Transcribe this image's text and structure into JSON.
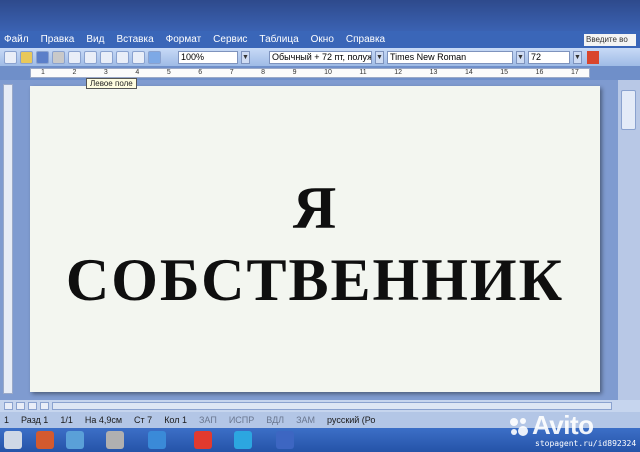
{
  "menu": {
    "items": [
      "Файл",
      "Правка",
      "Вид",
      "Вставка",
      "Формат",
      "Сервис",
      "Таблица",
      "Окно",
      "Справка"
    ],
    "help_box": "Введите во"
  },
  "toolbar": {
    "zoom": "100%",
    "style": "Обычный + 72 пт, полужи",
    "font": "Times New Roman",
    "size": "72"
  },
  "ruler": {
    "tooltip": "Левое поле",
    "ticks": [
      "1",
      "2",
      "3",
      "4",
      "5",
      "6",
      "7",
      "8",
      "9",
      "10",
      "11",
      "12",
      "13",
      "14",
      "15",
      "16",
      "17"
    ]
  },
  "document": {
    "line1": "Я",
    "line2": "СОБСТВЕННИК"
  },
  "statusbar": {
    "items": [
      {
        "text": "1",
        "dim": false
      },
      {
        "text": "Разд 1",
        "dim": false
      },
      {
        "text": "1/1",
        "dim": false
      },
      {
        "text": "На 4,9см",
        "dim": false
      },
      {
        "text": "Ст 7",
        "dim": false
      },
      {
        "text": "Кол 1",
        "dim": false
      },
      {
        "text": "ЗАП",
        "dim": true
      },
      {
        "text": "ИСПР",
        "dim": true
      },
      {
        "text": "ВДЛ",
        "dim": true
      },
      {
        "text": "ЗАМ",
        "dim": true
      },
      {
        "text": "русский (Ро",
        "dim": false
      }
    ]
  },
  "watermark": {
    "brand": "Avito",
    "url": "stopagent.ru/id892324"
  },
  "colors": {
    "menubar": "#3a66b8",
    "toolbar": "#9fbbe6",
    "page": "#f3f6f0",
    "text": "#0f0f0f",
    "taskbar": "#2553a8"
  }
}
